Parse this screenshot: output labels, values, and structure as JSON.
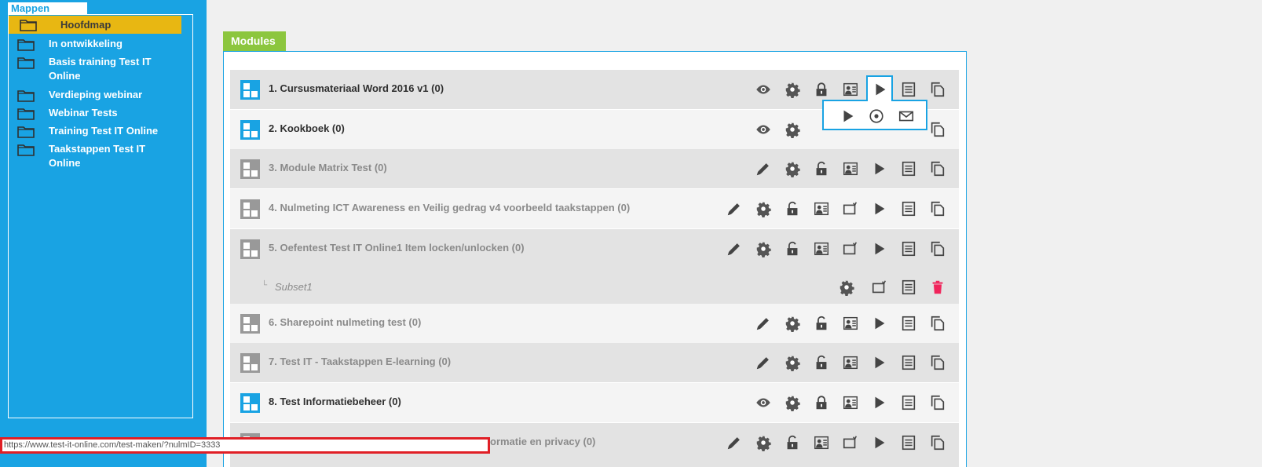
{
  "sidebar": {
    "tab_label": "Mappen",
    "root_folder": "Hoofdmap",
    "folders": [
      "In ontwikkeling",
      "Basis training Test IT Online",
      "Verdieping webinar",
      "Webinar Tests",
      "Training Test IT Online",
      "Taakstappen Test IT Online"
    ]
  },
  "main": {
    "tab_label": "Modules",
    "modules": [
      {
        "title": "1. Cursusmateriaal Word 2016 v1 (0)",
        "status": "active"
      },
      {
        "title": "2. Kookboek (0)",
        "status": "active"
      },
      {
        "title": "3. Module Matrix Test (0)",
        "status": "inactive"
      },
      {
        "title": "4. Nulmeting ICT Awareness en Veilig gedrag v4 voorbeeld taakstappen (0)",
        "status": "inactive"
      },
      {
        "title": "5. Oefentest Test IT Online1 Item locken/unlocken (0)",
        "status": "inactive"
      },
      {
        "title": "Subset1",
        "status": "subset"
      },
      {
        "title": "6. Sharepoint nulmeting test (0)",
        "status": "inactive"
      },
      {
        "title": "7. Test IT - Taakstappen E-learning (0)",
        "status": "inactive"
      },
      {
        "title": "8. Test Informatiebeheer (0)",
        "status": "active"
      },
      {
        "title": "ormatie en privacy (0)",
        "status": "inactive"
      }
    ]
  },
  "statusbar": {
    "url": "https://www.test-it-online.com/test-maken/?nulmID=3333"
  },
  "icons": {
    "view": "eye-icon",
    "edit": "pencil-icon",
    "settings": "gear-icon",
    "lock": "lock-icon",
    "unlock": "unlock-icon",
    "user_card": "user-card-icon",
    "screen": "screen-icon",
    "play": "play-icon",
    "list": "list-icon",
    "copy": "copy-icon",
    "delete": "trash-icon",
    "disc": "disc-icon",
    "mail": "mail-icon"
  },
  "colors": {
    "sidebar": "#19a3e3",
    "root_folder_bg": "#e8b712",
    "modules_tab": "#8cc63e",
    "delete_icon": "#f0245b",
    "statusbar_border": "#e01f26"
  }
}
